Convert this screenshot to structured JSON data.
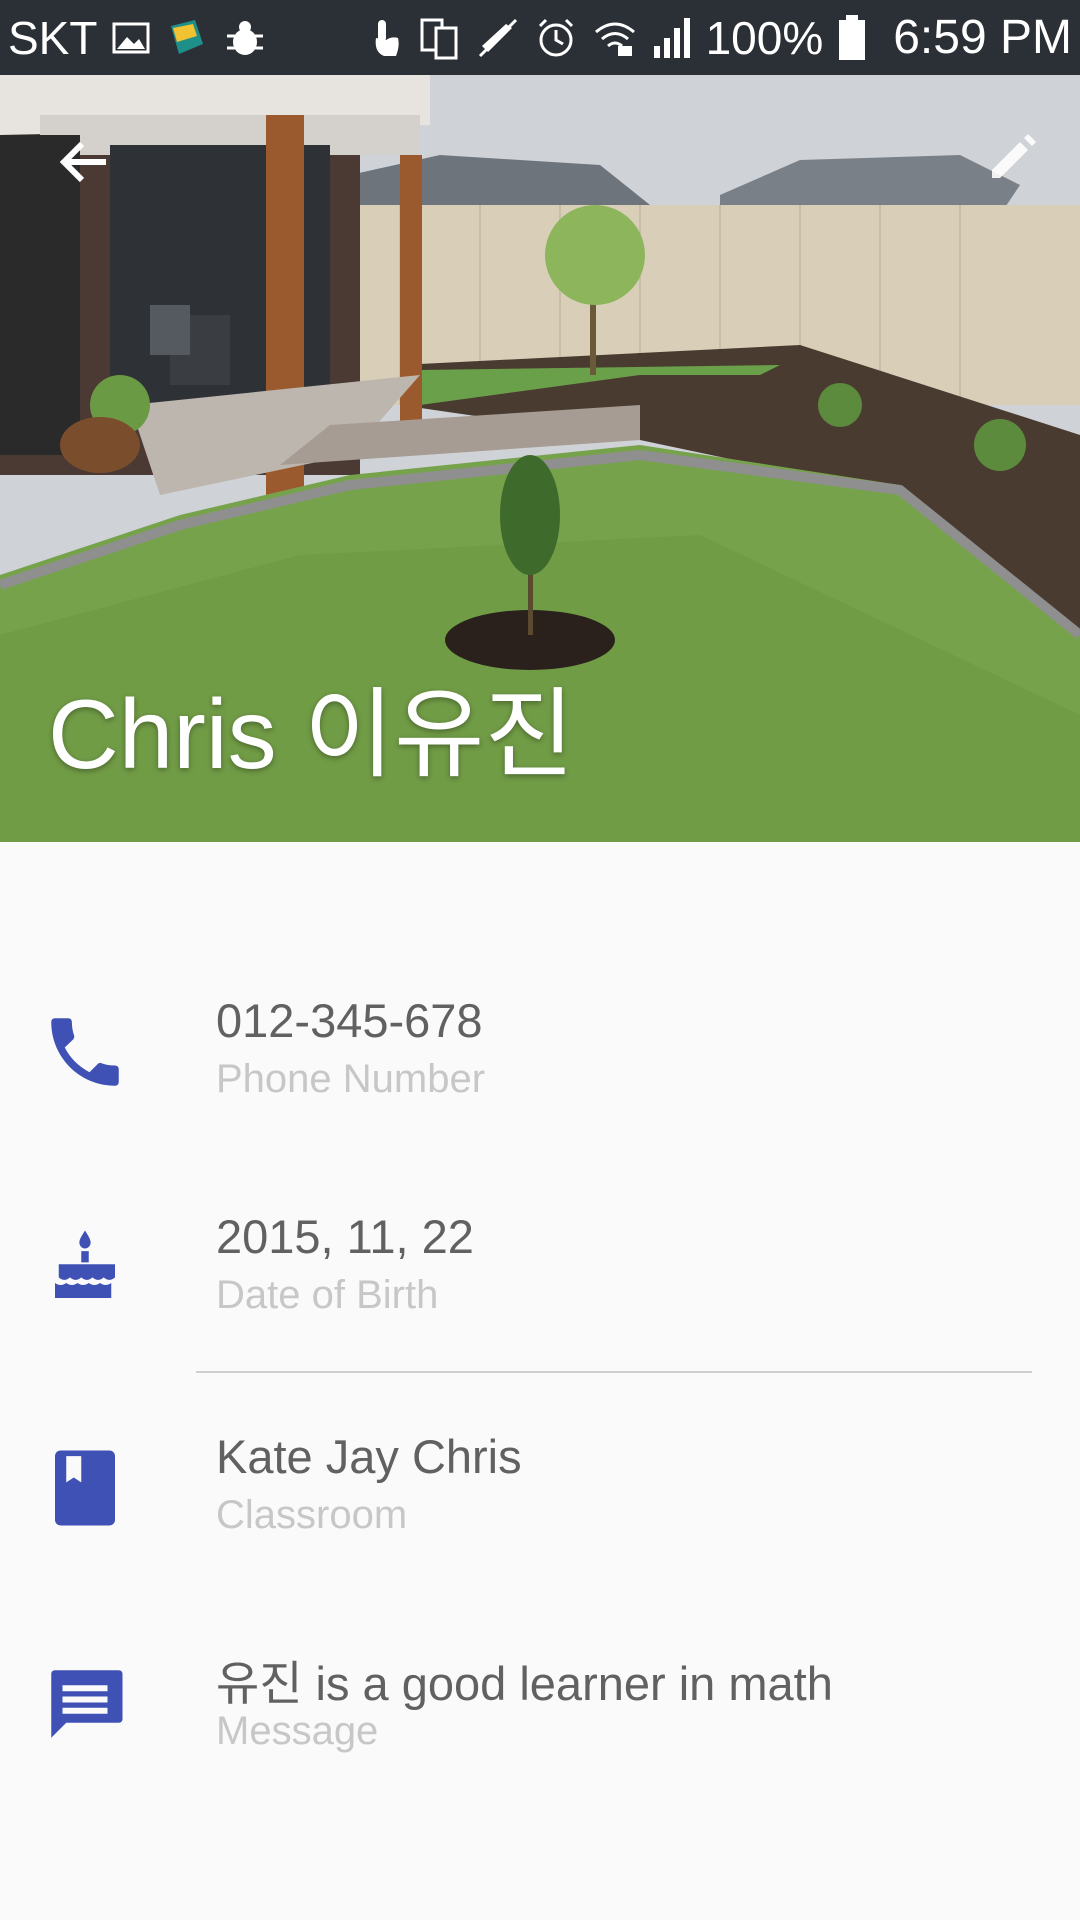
{
  "status_bar": {
    "carrier": "SKT",
    "battery_percent": "100%",
    "time": "6:59 PM",
    "icons": [
      "gallery-icon",
      "app-notification-icon",
      "bug-icon",
      "touch-icon",
      "phone-sync-icon",
      "mute-icon",
      "alarm-icon",
      "wifi-icon",
      "signal-icon",
      "battery-icon"
    ]
  },
  "header": {
    "name": "Chris 이유진",
    "back_icon": "arrow-left-icon",
    "edit_icon": "edit-icon"
  },
  "details": [
    {
      "icon": "phone-icon",
      "value": "012-345-678",
      "label": "Phone Number"
    },
    {
      "icon": "cake-icon",
      "value": "2015, 11, 22",
      "label": "Date of Birth"
    },
    {
      "icon": "book-icon",
      "value": "Kate Jay Chris",
      "label": "Classroom"
    },
    {
      "icon": "message-icon",
      "value": "유진 is a good learner in math",
      "label": "Message"
    }
  ],
  "colors": {
    "accent": "#3f51b5",
    "status_bar": "#2b2f36",
    "value_text": "#616161",
    "label_text": "#c7c7c7"
  }
}
